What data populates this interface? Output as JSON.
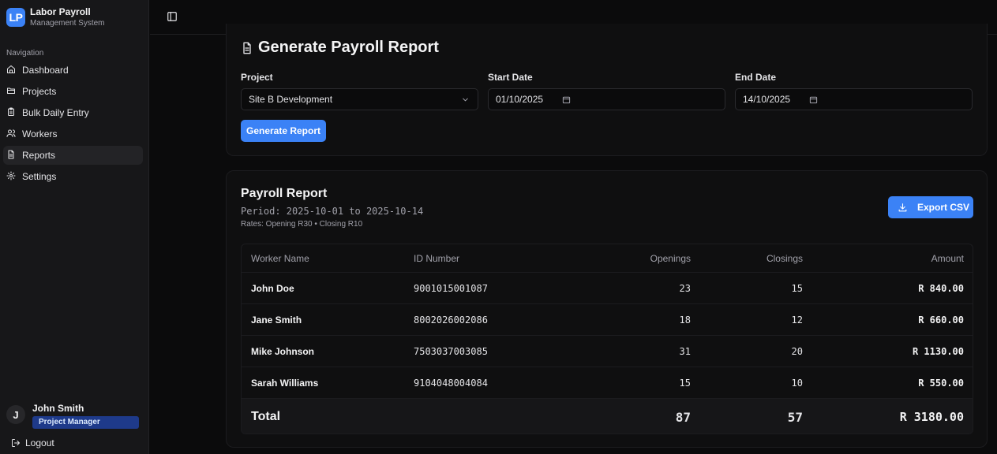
{
  "app": {
    "logo": "LP",
    "title": "Labor Payroll",
    "subtitle": "Management System"
  },
  "sidebar": {
    "heading": "Navigation",
    "items": [
      {
        "label": "Dashboard",
        "icon": "home-icon"
      },
      {
        "label": "Projects",
        "icon": "folder-icon"
      },
      {
        "label": "Bulk Daily Entry",
        "icon": "clipboard-icon"
      },
      {
        "label": "Workers",
        "icon": "users-icon"
      },
      {
        "label": "Reports",
        "icon": "file-text-icon",
        "active": true
      },
      {
        "label": "Settings",
        "icon": "gear-icon"
      }
    ],
    "user": {
      "initial": "J",
      "name": "John Smith",
      "role": "Project Manager"
    },
    "logout_label": "Logout"
  },
  "generate": {
    "title": "Generate Payroll Report",
    "project_label": "Project",
    "project_value": "Site B Development",
    "start_label": "Start Date",
    "start_value": "01/10/2025",
    "end_label": "End Date",
    "end_value": "14/10/2025",
    "button_label": "Generate Report"
  },
  "report": {
    "title": "Payroll Report",
    "period": "Period: 2025-10-01 to 2025-10-14",
    "rates": "Rates: Opening R30 • Closing R10",
    "export_label": "Export CSV",
    "columns": [
      "Worker Name",
      "ID Number",
      "Openings",
      "Closings",
      "Amount"
    ],
    "rows": [
      {
        "name": "John Doe",
        "id": "9001015001087",
        "openings": "23",
        "closings": "15",
        "amount": "R 840.00"
      },
      {
        "name": "Jane Smith",
        "id": "8002026002086",
        "openings": "18",
        "closings": "12",
        "amount": "R 660.00"
      },
      {
        "name": "Mike Johnson",
        "id": "7503037003085",
        "openings": "31",
        "closings": "20",
        "amount": "R 1130.00"
      },
      {
        "name": "Sarah Williams",
        "id": "9104048004084",
        "openings": "15",
        "closings": "10",
        "amount": "R 550.00"
      }
    ],
    "total": {
      "label": "Total",
      "openings": "87",
      "closings": "57",
      "amount": "R 3180.00"
    }
  },
  "colors": {
    "accent": "#3b82f6",
    "background": "#0b0b0c",
    "sidebar": "#171719",
    "role_badge": "#1e3a8a"
  }
}
